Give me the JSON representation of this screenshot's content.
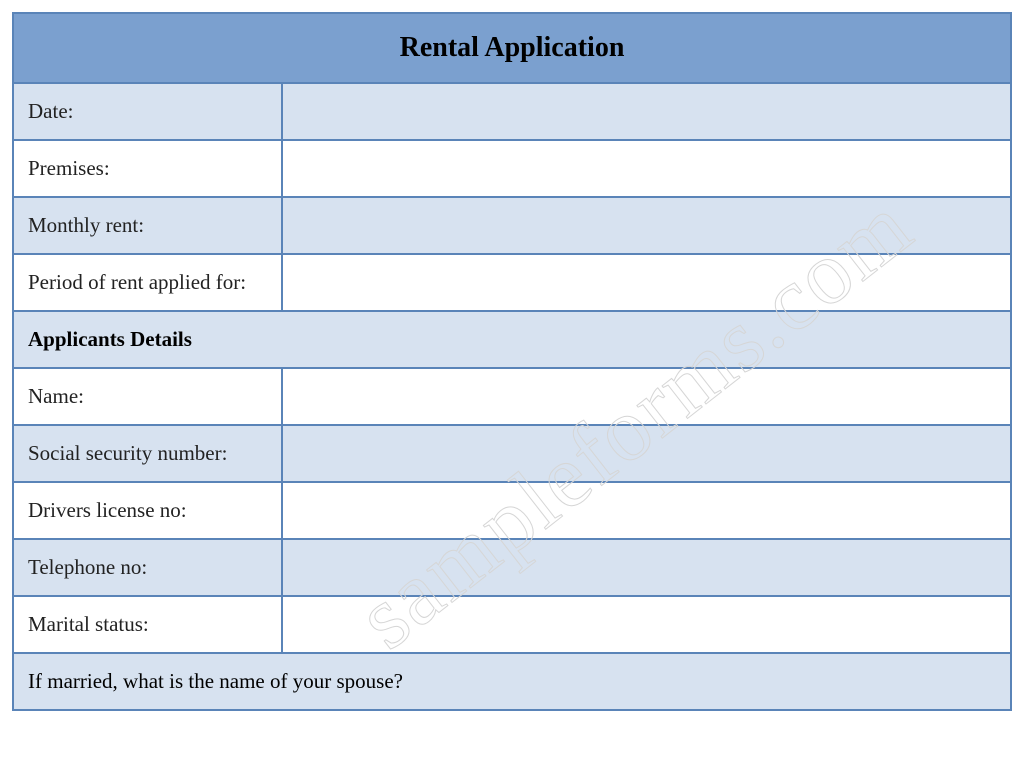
{
  "title": "Rental Application",
  "watermark": "sampleforms.com",
  "rows": {
    "date": {
      "label": "Date:",
      "value": ""
    },
    "premises": {
      "label": "Premises:",
      "value": ""
    },
    "monthly_rent": {
      "label": "Monthly rent:",
      "value": ""
    },
    "period": {
      "label": "Period of rent applied for:",
      "value": ""
    },
    "section_applicants": "Applicants Details",
    "name": {
      "label": "Name:",
      "value": ""
    },
    "ssn": {
      "label": "Social security number:",
      "value": ""
    },
    "dl": {
      "label": "Drivers license no:",
      "value": ""
    },
    "tel": {
      "label": "Telephone no:",
      "value": ""
    },
    "marital": {
      "label": "Marital status:",
      "value": ""
    },
    "spouse_question": "If married, what is the name of your spouse?"
  }
}
